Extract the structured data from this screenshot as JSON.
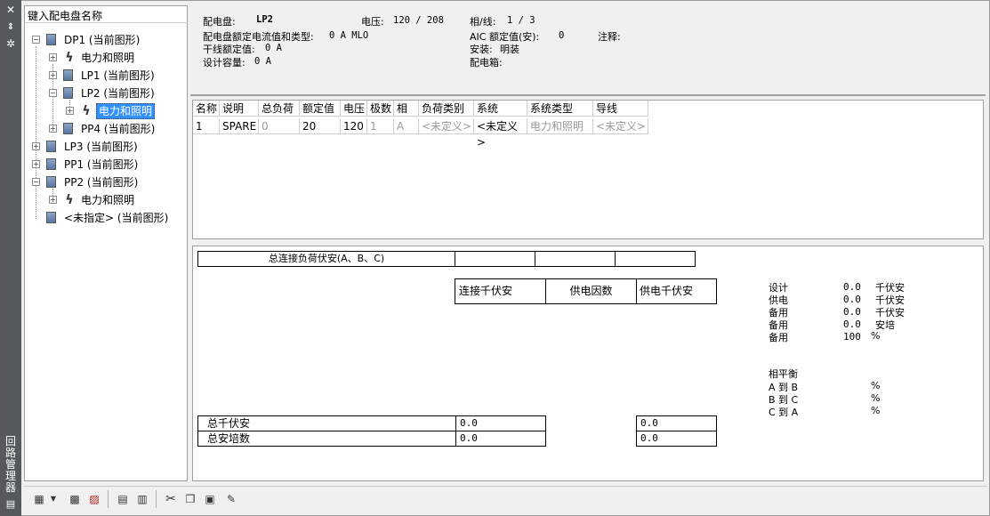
{
  "window": {
    "strip_title_chars": [
      "回",
      "路",
      "管",
      "理",
      "器"
    ],
    "close_glyph": "✕"
  },
  "tree": {
    "search_placeholder": "键入配电盘名称",
    "nodes": [
      {
        "label": "DP1 (当前图形)",
        "type": "panel",
        "level": 0
      },
      {
        "label": "电力和照明",
        "type": "system",
        "level": 1
      },
      {
        "label": "LP1 (当前图形)",
        "type": "panel",
        "level": 1
      },
      {
        "label": "LP2 (当前图形)",
        "type": "panel",
        "level": 1
      },
      {
        "label": "电力和照明",
        "type": "system",
        "level": 2,
        "selected": true
      },
      {
        "label": "PP4 (当前图形)",
        "type": "panel",
        "level": 1
      },
      {
        "label": "LP3 (当前图形)",
        "type": "panel",
        "level": 0
      },
      {
        "label": "PP1 (当前图形)",
        "type": "panel",
        "level": 0
      },
      {
        "label": "PP2 (当前图形)",
        "type": "panel",
        "level": 0
      },
      {
        "label": "电力和照明",
        "type": "system",
        "level": 1
      },
      {
        "label": "<未指定> (当前图形)",
        "type": "panel",
        "level": 0
      }
    ]
  },
  "info": {
    "panel_label": "配电盘:",
    "panel_value": "LP2",
    "voltage_label": "电压:",
    "voltage_value": "120 / 208",
    "phase_label": "相/线:",
    "phase_value": "1 / 3",
    "rating_label": "配电盘额定电流值和类型:",
    "rating_value": "0 A MLO",
    "aic_label": "AIC 额定值(安):",
    "aic_value": "0",
    "notes_label": "注释:",
    "feeder_label": "干线额定值:",
    "feeder_value": "0 A",
    "mount_label": "安装:",
    "mount_value": "明装",
    "design_label": "设计容量:",
    "design_value": "0 A",
    "enclosure_label": "配电箱:"
  },
  "grid": {
    "headers": [
      "名称",
      "说明",
      "总负荷",
      "额定值",
      "电压",
      "极数",
      "相",
      "负荷类别",
      "系统",
      "系统类型",
      "导线"
    ],
    "row": [
      "1",
      "SPARE",
      "0",
      "20",
      "120",
      "1",
      "A",
      "<未定义>",
      "<未定义>",
      "电力和照明",
      "<未定义>"
    ]
  },
  "summary": {
    "total_connected_label": "总连接负荷伏安(A、B、C)",
    "col_connected_kva": "连接千伏安",
    "col_demand_factor": "供电因数",
    "col_demand_kva": "供电千伏安",
    "total_kva_label": "总千伏安",
    "total_amps_label": "总安培数",
    "total_kva_value": "0.0",
    "total_amps_value": "0.0",
    "total_kva_demand": "0.0",
    "total_amps_demand": "0.0",
    "right_rows": [
      {
        "label": "设计",
        "value": "0.0",
        "unit": "千伏安"
      },
      {
        "label": "供电",
        "value": "0.0",
        "unit": "千伏安"
      },
      {
        "label": "备用",
        "value": "0.0",
        "unit": "千伏安"
      },
      {
        "label": "备用",
        "value": "0.0",
        "unit": "安培"
      },
      {
        "label": "备用",
        "value": "100",
        "unit": "%"
      }
    ],
    "balance_title": "相平衡",
    "balance_rows": [
      {
        "label": "A 到 B",
        "unit": "%"
      },
      {
        "label": "B 到 C",
        "unit": "%"
      },
      {
        "label": "C 到 A",
        "unit": "%"
      }
    ]
  },
  "colors": {
    "selection": "#3390ff",
    "strip": "#55585c"
  }
}
